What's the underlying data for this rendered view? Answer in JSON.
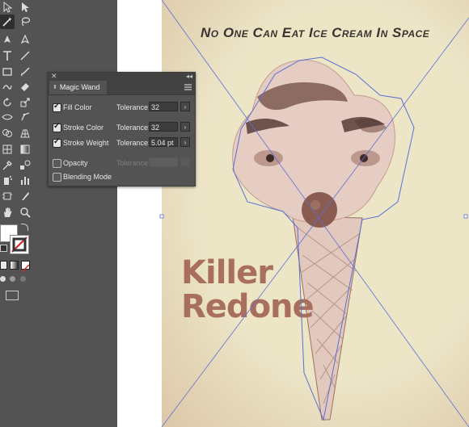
{
  "poster": {
    "title": "No One Can Eat Ice Cream In Space",
    "headline_line1": "Killer",
    "headline_line2": "Redone"
  },
  "magic_wand_panel": {
    "tab_title": "Magic Wand",
    "tolerance_label": "Tolerance:",
    "rows": [
      {
        "label": "Fill Color",
        "checked": true,
        "tolerance": "32",
        "enabled": true
      },
      {
        "label": "Stroke Color",
        "checked": true,
        "tolerance": "32",
        "enabled": true
      },
      {
        "label": "Stroke Weight",
        "checked": true,
        "tolerance": "5.04 pt",
        "enabled": true
      },
      {
        "label": "Opacity",
        "checked": false,
        "tolerance": "",
        "enabled": false
      },
      {
        "label": "Blending Mode",
        "checked": false,
        "tolerance": null,
        "enabled": false
      }
    ]
  },
  "colors": {
    "ui_panel": "#535353",
    "poster_bg": "#ece6c7",
    "headline": "#a86f5f",
    "selection_path": "#5b6fd6"
  },
  "tools": [
    "selection-tool-icon",
    "direct-selection-tool-icon",
    "magic-wand-tool-icon",
    "lasso-tool-icon",
    "pen-tool-icon",
    "curvature-tool-icon",
    "type-tool-icon",
    "line-segment-tool-icon",
    "rectangle-tool-icon",
    "paintbrush-tool-icon",
    "shaper-tool-icon",
    "eraser-tool-icon",
    "rotate-tool-icon",
    "scale-tool-icon",
    "width-tool-icon",
    "free-transform-tool-icon",
    "shape-builder-tool-icon",
    "perspective-grid-tool-icon",
    "mesh-tool-icon",
    "gradient-tool-icon",
    "eyedropper-tool-icon",
    "blend-tool-icon",
    "symbol-sprayer-tool-icon",
    "column-graph-tool-icon",
    "artboard-tool-icon",
    "slice-tool-icon",
    "hand-tool-icon",
    "zoom-tool-icon"
  ]
}
